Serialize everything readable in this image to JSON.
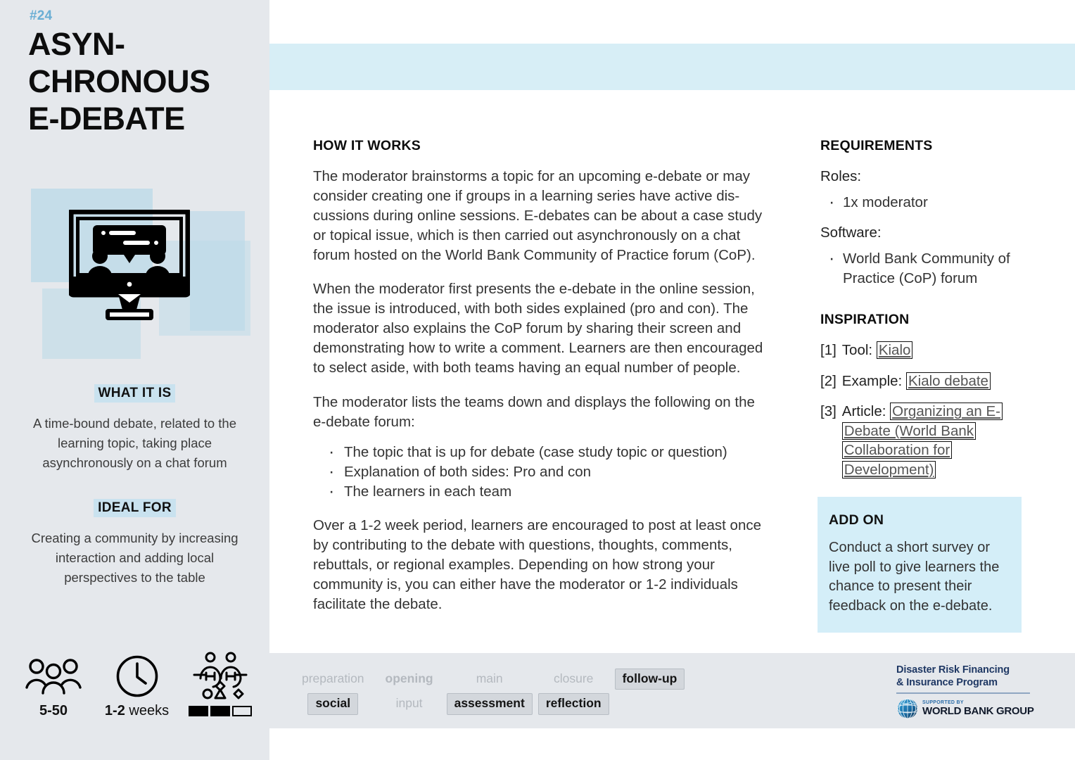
{
  "card": {
    "number": "#24",
    "title": "ASYN-\nCHRONOUS\nE-DEBATE",
    "icon_name": "monitor-chat-debate-icon"
  },
  "sidebar": {
    "what_it_is": {
      "heading": "WHAT IT IS",
      "body": "A time-bound debate, related to the learning topic, taking place asynchronously on a chat forum"
    },
    "ideal_for": {
      "heading": "IDEAL FOR",
      "body": "Creating a community by increasing interaction and adding local perspectives to the table"
    },
    "stats": [
      {
        "icon": "group-of-people-icon",
        "value_bold": "5-50",
        "value_light": ""
      },
      {
        "icon": "clock-icon",
        "value_bold": "1-2",
        "value_light": " weeks"
      },
      {
        "icon": "complexity-people-shapes-icon",
        "value_bold": "",
        "value_light": "",
        "level_filled": 2,
        "level_total": 3
      }
    ]
  },
  "how_it_works": {
    "heading": "HOW IT WORKS",
    "paragraphs": [
      "The moderator brainstorms a topic for an upcoming e-debate or may consider creating one if groups in a learning series have active dis-cussions during online sessions. E-debates can be about a case study or topical issue, which is then carried out asynchronously on a chat forum hosted on the World Bank Community of Practice forum (CoP).",
      "When the moderator first presents the e-debate in the online session, the issue is introduced, with both sides explained (pro and con). The moderator also explains the CoP forum by sharing their screen and demonstrating how to write a comment. Learners are then encouraged to select aside, with both teams having an equal number of people.",
      "The moderator lists the teams down and displays the following on the e-debate forum:"
    ],
    "bullets": [
      "The topic that is up for debate (case study topic or question)",
      "Explanation of both sides: Pro and con",
      "The learners in each team"
    ],
    "closing_paragraph": "Over a 1-2 week period, learners are encouraged to post at least once by contributing to the debate with questions, thoughts, comments, rebuttals, or regional examples. Depending on how strong your community is, you can either have the moderator or 1-2 individuals facilitate the debate."
  },
  "requirements": {
    "heading": "REQUIREMENTS",
    "roles_label": "Roles:",
    "roles": [
      "1x moderator"
    ],
    "software_label": "Software:",
    "software": [
      "World Bank Community of Practice (CoP) forum"
    ]
  },
  "inspiration": {
    "heading": "INSPIRATION",
    "items": [
      {
        "index": "[1]",
        "kind": "Tool:",
        "link": "Kialo"
      },
      {
        "index": "[2]",
        "kind": "Example:",
        "link": "Kialo debate"
      },
      {
        "index": "[3]",
        "kind": "Article:",
        "link": "Organizing an E-Debate (World Bank Collaboration for Development)"
      }
    ]
  },
  "add_on": {
    "heading": "ADD ON",
    "body": "Conduct a short survey or live poll to give learners the chance to present their feedback on the e-debate."
  },
  "footer": {
    "tag_columns": [
      {
        "top": {
          "label": "preparation",
          "active": false,
          "bold": false
        },
        "bottom": {
          "label": "social",
          "active": true
        }
      },
      {
        "top": {
          "label": "opening",
          "active": false,
          "bold": true
        },
        "bottom": {
          "label": "input",
          "active": false
        }
      },
      {
        "top": {
          "label": "main",
          "active": false,
          "bold": false
        },
        "bottom": {
          "label": "assessment",
          "active": true
        }
      },
      {
        "top": {
          "label": "closure",
          "active": false,
          "bold": false
        },
        "bottom": {
          "label": "reflection",
          "active": true
        }
      },
      {
        "top": {
          "label": "follow-up",
          "active": true
        },
        "bottom": {
          "label": "",
          "active": false
        }
      }
    ],
    "logo": {
      "program_line1": "Disaster Risk Financing",
      "program_line2": "& Insurance Program",
      "supported_by": "SUPPORTED BY",
      "organization": "WORLD BANK GROUP",
      "globe_icon": "world-bank-globe-icon"
    }
  },
  "colors": {
    "sidebar_bg": "#e5e8ec",
    "accent_blue": "#6aaed4",
    "band_blue": "#d7eef6",
    "highlight_blue": "#c9e2ef",
    "addon_blue": "#d4eef8",
    "tag_active_bg": "#d3d7dc",
    "tag_inactive_text": "#b4b9bf"
  }
}
